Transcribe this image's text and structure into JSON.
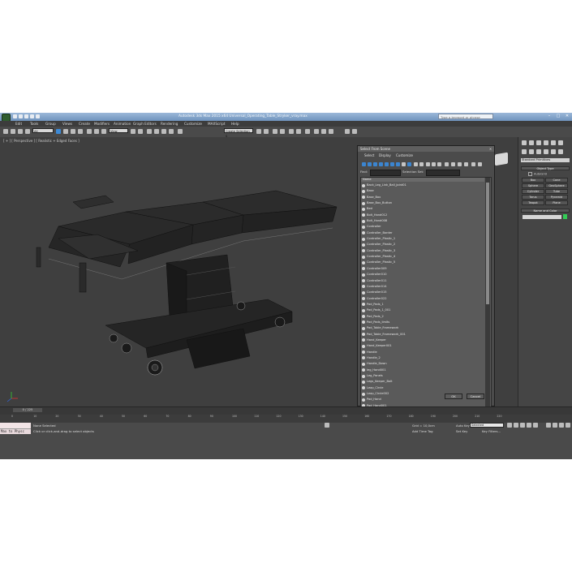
{
  "window": {
    "title": "Autodesk 3ds Max 2015 x64     Universal_Operating_Table_Stryker_vray.max",
    "search_placeholder": "Type a keyword or phrase",
    "buttons": [
      "–",
      "□",
      "✕"
    ]
  },
  "menu": [
    "Edit",
    "Tools",
    "Group",
    "Views",
    "Create",
    "Modifiers",
    "Animation",
    "Graph Editors",
    "Rendering",
    "Customize",
    "MAXScript",
    "Help"
  ],
  "toolbar": {
    "filter": "All",
    "ref_coord": "View",
    "selection_set": "Create Selection S"
  },
  "viewport": {
    "label": "[ + ] [ Perspective ] [ Realistic + Edged Faces ]"
  },
  "command_panel": {
    "category": "Standard Primitives",
    "object_type_label": "Object Type",
    "autogrid_label": "AutoGrid",
    "objects": [
      "Box",
      "Cone",
      "Sphere",
      "GeoSphere",
      "Cylinder",
      "Tube",
      "Torus",
      "Pyramid",
      "Teapot",
      "Plane"
    ],
    "name_color_label": "Name and Color"
  },
  "dialog": {
    "title": "Select From Scene",
    "menu": [
      "Select",
      "Display",
      "Customize"
    ],
    "find_label": "Find:",
    "selection_set_label": "Selection Set:",
    "column_header": "Name",
    "items": [
      "Back_Leg_Link_Ball_Joint01",
      "Base",
      "Base_Box",
      "Base_Box_Button",
      "Bed",
      "Bolt_Hand012",
      "Bolt_Hand008",
      "Controller",
      "Controller_Border",
      "Controller_Plastic_1",
      "Controller_Plastic_2",
      "Controller_Plastic_3",
      "Controller_Plastic_4",
      "Controller_Plastic_5",
      "Controller009",
      "Controller010",
      "Controller011",
      "Controller014",
      "Controller015",
      "Controller022",
      "Pad_Pads_1",
      "Pad_Pads_1_001",
      "Pad_Pads_2",
      "Pad_Pads_limits",
      "Pad_Table_Framework",
      "Pad_Table_Framework_001",
      "Hand_Keeper",
      "Hand_Keeper001",
      "Handle",
      "Handle_2",
      "Handle_Down",
      "leg_Hand001",
      "Leg_Panels",
      "Legs_Keeper_Bolt",
      "Leap_Circle",
      "Leap_Circle002",
      "Pad_Hand",
      "Pad_Hand001"
    ],
    "ok": "OK",
    "cancel": "Cancel"
  },
  "timeline": {
    "frame": "0 / 225",
    "ticks": [
      "0",
      "10",
      "20",
      "30",
      "40",
      "50",
      "60",
      "70",
      "80",
      "90",
      "100",
      "110",
      "120",
      "130",
      "140",
      "150",
      "160",
      "170",
      "180",
      "190",
      "200",
      "210",
      "220"
    ]
  },
  "status": {
    "maxscript": "Max to Physc",
    "selection": "None Selected",
    "prompt": "Click or click-and-drag to select objects",
    "grid": "Grid = 10,0cm",
    "add_time_tag": "Add Time Tag",
    "auto_key": "Auto Key",
    "selected": "Selected",
    "set_key": "Set Key",
    "key_filters": "Key Filters..."
  },
  "colors": {
    "viewport_bg": "#3f3f3f",
    "accent": "#3d8ad6",
    "object_color": "#33cc55"
  }
}
